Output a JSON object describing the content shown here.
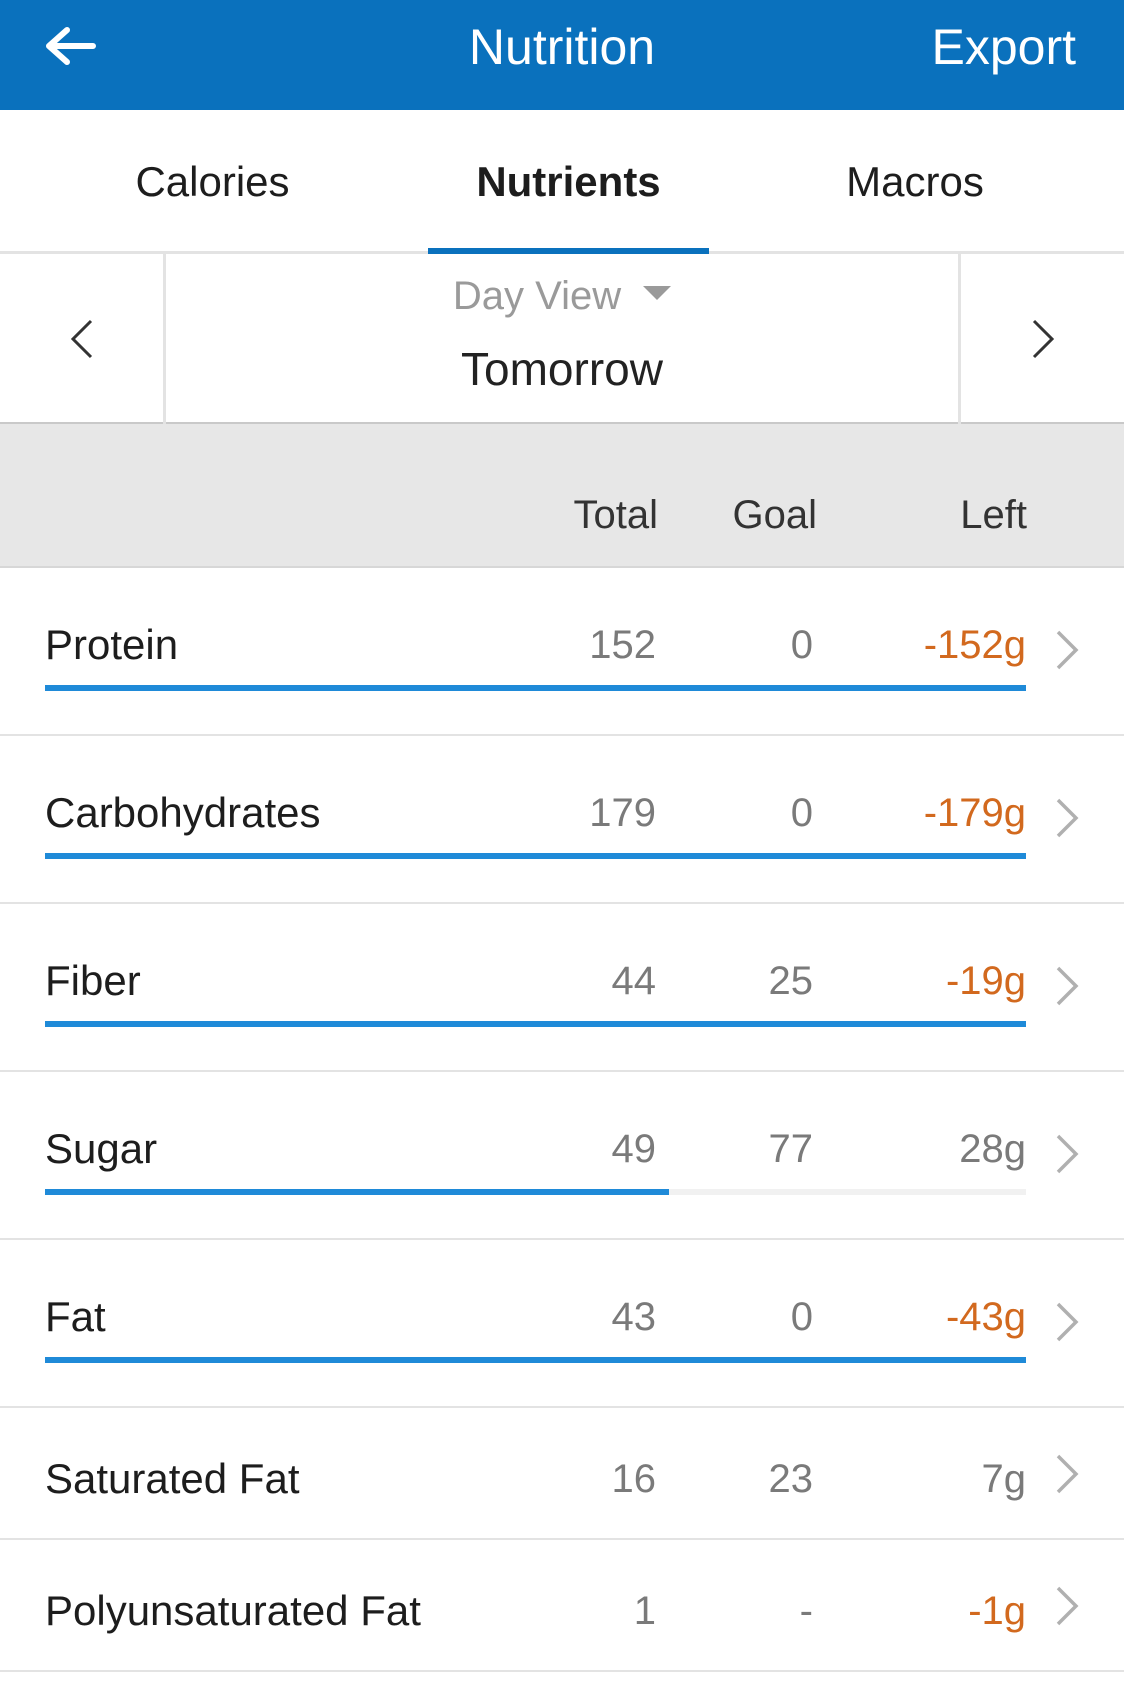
{
  "header": {
    "title": "Nutrition",
    "export_label": "Export",
    "accent_color": "#0a71bd"
  },
  "tabs": [
    {
      "label": "Calories",
      "selected": false
    },
    {
      "label": "Nutrients",
      "selected": true
    },
    {
      "label": "Macros",
      "selected": false
    }
  ],
  "date_nav": {
    "view_label": "Day View",
    "date_label": "Tomorrow"
  },
  "columns": {
    "total": "Total",
    "goal": "Goal",
    "left": "Left"
  },
  "nutrients": [
    {
      "name": "Protein",
      "total": "152",
      "goal": "0",
      "left": "-152g",
      "over_goal": true,
      "progress_fraction": 1.0
    },
    {
      "name": "Carbohydrates",
      "total": "179",
      "goal": "0",
      "left": "-179g",
      "over_goal": true,
      "progress_fraction": 1.0
    },
    {
      "name": "Fiber",
      "total": "44",
      "goal": "25",
      "left": "-19g",
      "over_goal": true,
      "progress_fraction": 1.0
    },
    {
      "name": "Sugar",
      "total": "49",
      "goal": "77",
      "left": "28g",
      "over_goal": false,
      "progress_fraction": 0.636
    },
    {
      "name": "Fat",
      "total": "43",
      "goal": "0",
      "left": "-43g",
      "over_goal": true,
      "progress_fraction": 1.0
    },
    {
      "name": "Saturated Fat",
      "total": "16",
      "goal": "23",
      "left": "7g",
      "over_goal": false
    },
    {
      "name": "Polyunsaturated Fat",
      "total": "1",
      "goal": "-",
      "left": "-1g",
      "over_goal": true
    }
  ],
  "colors": {
    "progress_bar": "#1f8ad8",
    "negative_left": "#d2691e"
  }
}
